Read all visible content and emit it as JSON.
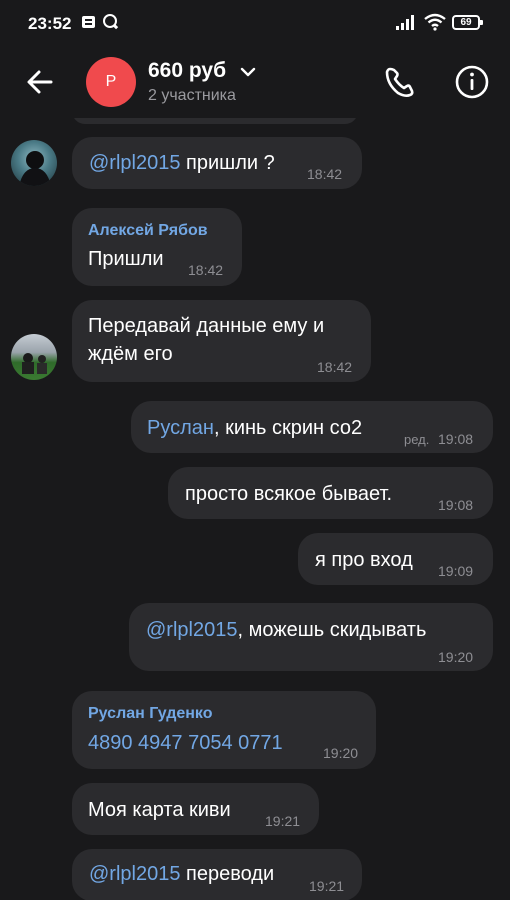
{
  "status_bar": {
    "time": "23:52",
    "battery": "69"
  },
  "header": {
    "avatar_letter": "Р",
    "title": "660 руб",
    "subtitle": "2 участника"
  },
  "messages": [
    {
      "mention": "@rlpl2015",
      "text": " пришли ?",
      "time": "18:42"
    },
    {
      "sender": "Алексей Рябов",
      "text": "Пришли",
      "time": "18:42"
    },
    {
      "line1": "Передавай данные ему и",
      "line2": "ждём его",
      "time": "18:42"
    },
    {
      "mention": "Руслан",
      "text": ", кинь скрин со2",
      "edited": "ред.",
      "time": "19:08"
    },
    {
      "text": "просто всякое бывает.",
      "time": "19:08"
    },
    {
      "text": "я про вход",
      "time": "19:09"
    },
    {
      "mention": "@rlpl2015",
      "text": ",  можешь скидывать",
      "time": "19:20"
    },
    {
      "sender": "Руслан Гуденко",
      "link": "4890 4947 7054 0771",
      "time": "19:20"
    },
    {
      "text": "Моя карта киви",
      "time": "19:21"
    },
    {
      "mention": "@rlpl2015",
      "text": " переводи",
      "time": "19:21"
    }
  ]
}
